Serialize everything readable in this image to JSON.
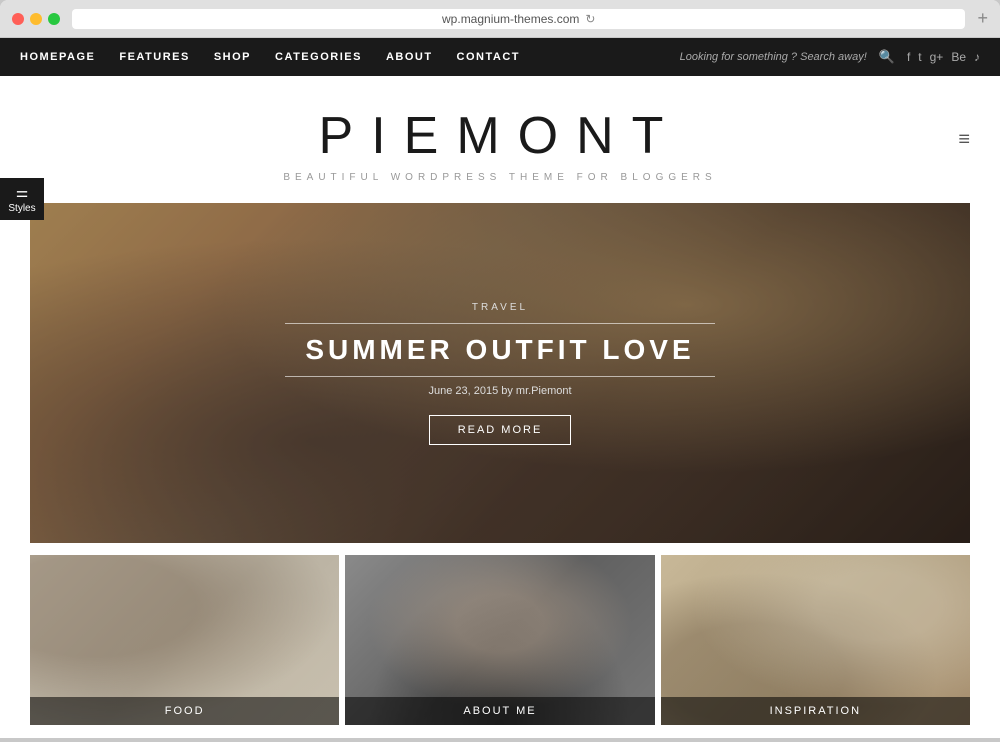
{
  "browser": {
    "url": "wp.magnium-themes.com",
    "new_tab_label": "+"
  },
  "nav": {
    "links": [
      "HOMEPAGE",
      "FEATURES",
      "SHOP",
      "CATEGORIES",
      "ABOUT",
      "CONTACT"
    ],
    "search_prompt": "Looking for something ? Search away!",
    "social": [
      "f",
      "t",
      "g+",
      "Be",
      "♪"
    ]
  },
  "site": {
    "title": "PIEMONT",
    "tagline": "BEAUTIFUL  WORDPRESS THEME FOR BLOGGERS"
  },
  "hero": {
    "category": "TRAVEL",
    "title": "SUMMER OUTFIT LOVE",
    "meta": "June 23, 2015 by mr.Piemont",
    "read_more": "READ MORE"
  },
  "thumbnails": [
    {
      "label": "Food"
    },
    {
      "label": "About me"
    },
    {
      "label": "Inspiration"
    }
  ],
  "styles_widget": {
    "label": "Styles"
  }
}
